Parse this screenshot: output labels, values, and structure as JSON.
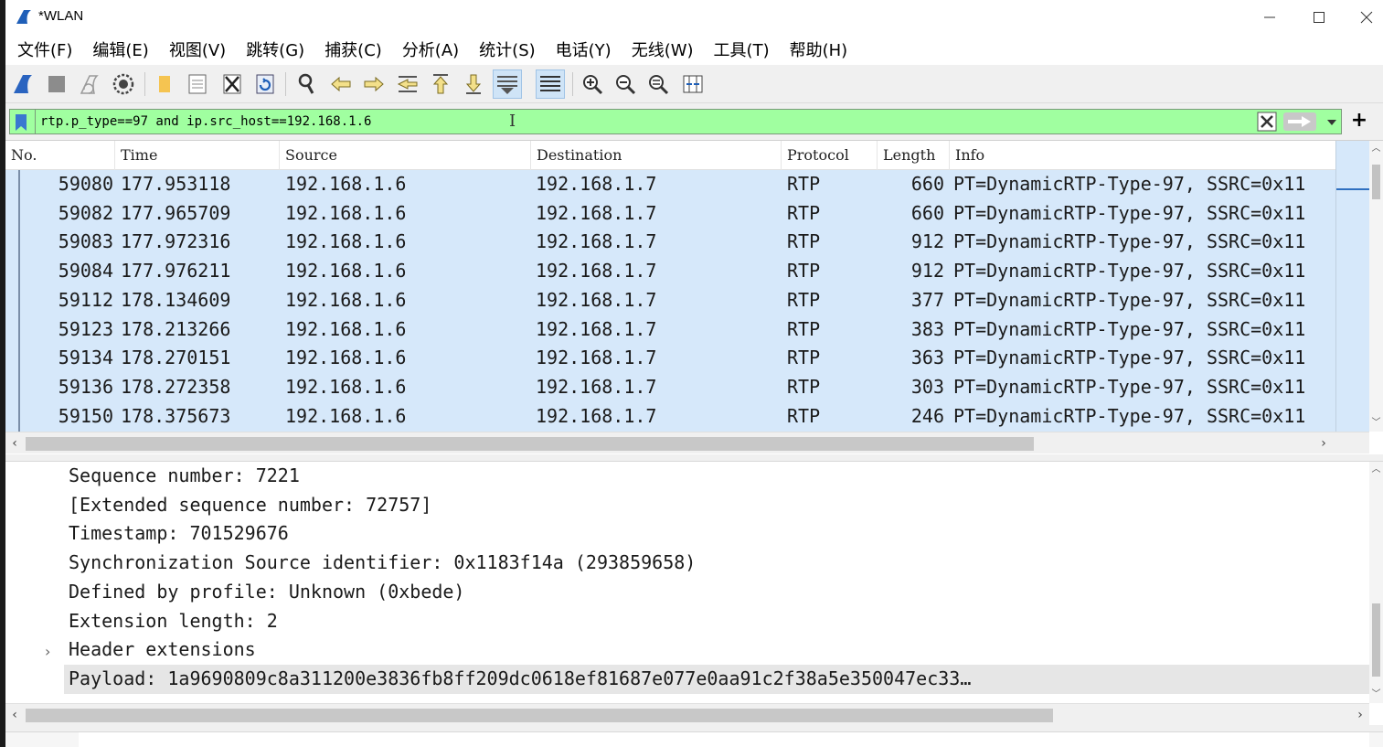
{
  "window": {
    "title": "*WLAN"
  },
  "menu": [
    "文件(F)",
    "编辑(E)",
    "视图(V)",
    "跳转(G)",
    "捕获(C)",
    "分析(A)",
    "统计(S)",
    "电话(Y)",
    "无线(W)",
    "工具(T)",
    "帮助(H)"
  ],
  "toolbar": {
    "buttons": [
      "shark-fin-start-icon",
      "stop-square-icon",
      "restart-fin-icon",
      "capture-options-gear-icon",
      "open-folder-icon",
      "save-file-icon",
      "close-file-icon",
      "reload-icon",
      "find-packet-magnifier-icon",
      "go-back-arrow-icon",
      "go-forward-arrow-icon",
      "go-to-packet-icon",
      "go-first-icon",
      "go-last-icon",
      "auto-scroll-icon",
      "colorize-icon",
      "zoom-in-icon",
      "zoom-out-icon",
      "zoom-normal-icon",
      "resize-columns-icon"
    ]
  },
  "filter": {
    "value": "rtp.p_type==97 and ip.src_host==192.168.1.6",
    "background": "#a0ffa0"
  },
  "packet_list": {
    "columns": [
      "No.",
      "Time",
      "Source",
      "Destination",
      "Protocol",
      "Length",
      "Info"
    ],
    "rows": [
      {
        "no": "59080",
        "time": "177.953118",
        "src": "192.168.1.6",
        "dst": "192.168.1.7",
        "proto": "RTP",
        "len": "660",
        "info": "PT=DynamicRTP-Type-97, SSRC=0x11"
      },
      {
        "no": "59082",
        "time": "177.965709",
        "src": "192.168.1.6",
        "dst": "192.168.1.7",
        "proto": "RTP",
        "len": "660",
        "info": "PT=DynamicRTP-Type-97, SSRC=0x11"
      },
      {
        "no": "59083",
        "time": "177.972316",
        "src": "192.168.1.6",
        "dst": "192.168.1.7",
        "proto": "RTP",
        "len": "912",
        "info": "PT=DynamicRTP-Type-97, SSRC=0x11"
      },
      {
        "no": "59084",
        "time": "177.976211",
        "src": "192.168.1.6",
        "dst": "192.168.1.7",
        "proto": "RTP",
        "len": "912",
        "info": "PT=DynamicRTP-Type-97, SSRC=0x11"
      },
      {
        "no": "59112",
        "time": "178.134609",
        "src": "192.168.1.6",
        "dst": "192.168.1.7",
        "proto": "RTP",
        "len": "377",
        "info": "PT=DynamicRTP-Type-97, SSRC=0x11"
      },
      {
        "no": "59123",
        "time": "178.213266",
        "src": "192.168.1.6",
        "dst": "192.168.1.7",
        "proto": "RTP",
        "len": "383",
        "info": "PT=DynamicRTP-Type-97, SSRC=0x11"
      },
      {
        "no": "59134",
        "time": "178.270151",
        "src": "192.168.1.6",
        "dst": "192.168.1.7",
        "proto": "RTP",
        "len": "363",
        "info": "PT=DynamicRTP-Type-97, SSRC=0x11"
      },
      {
        "no": "59136",
        "time": "178.272358",
        "src": "192.168.1.6",
        "dst": "192.168.1.7",
        "proto": "RTP",
        "len": "303",
        "info": "PT=DynamicRTP-Type-97, SSRC=0x11"
      },
      {
        "no": "59150",
        "time": "178.375673",
        "src": "192.168.1.6",
        "dst": "192.168.1.7",
        "proto": "RTP",
        "len": "246",
        "info": "PT=DynamicRTP-Type-97, SSRC=0x11"
      }
    ],
    "row_background": "#d6e8fa"
  },
  "details": {
    "lines": [
      "Sequence number: 7221",
      "[Extended sequence number: 72757]",
      "Timestamp: 701529676",
      "Synchronization Source identifier: 0x1183f14a (293859658)",
      "Defined by profile: Unknown (0xbede)",
      "Extension length: 2",
      "Header extensions",
      "Payload: 1a9690809c8a311200e3836fb8ff209dc0618ef81687e077e0aa91c2f38a5e350047ec33…"
    ],
    "expander_glyph": "›"
  }
}
